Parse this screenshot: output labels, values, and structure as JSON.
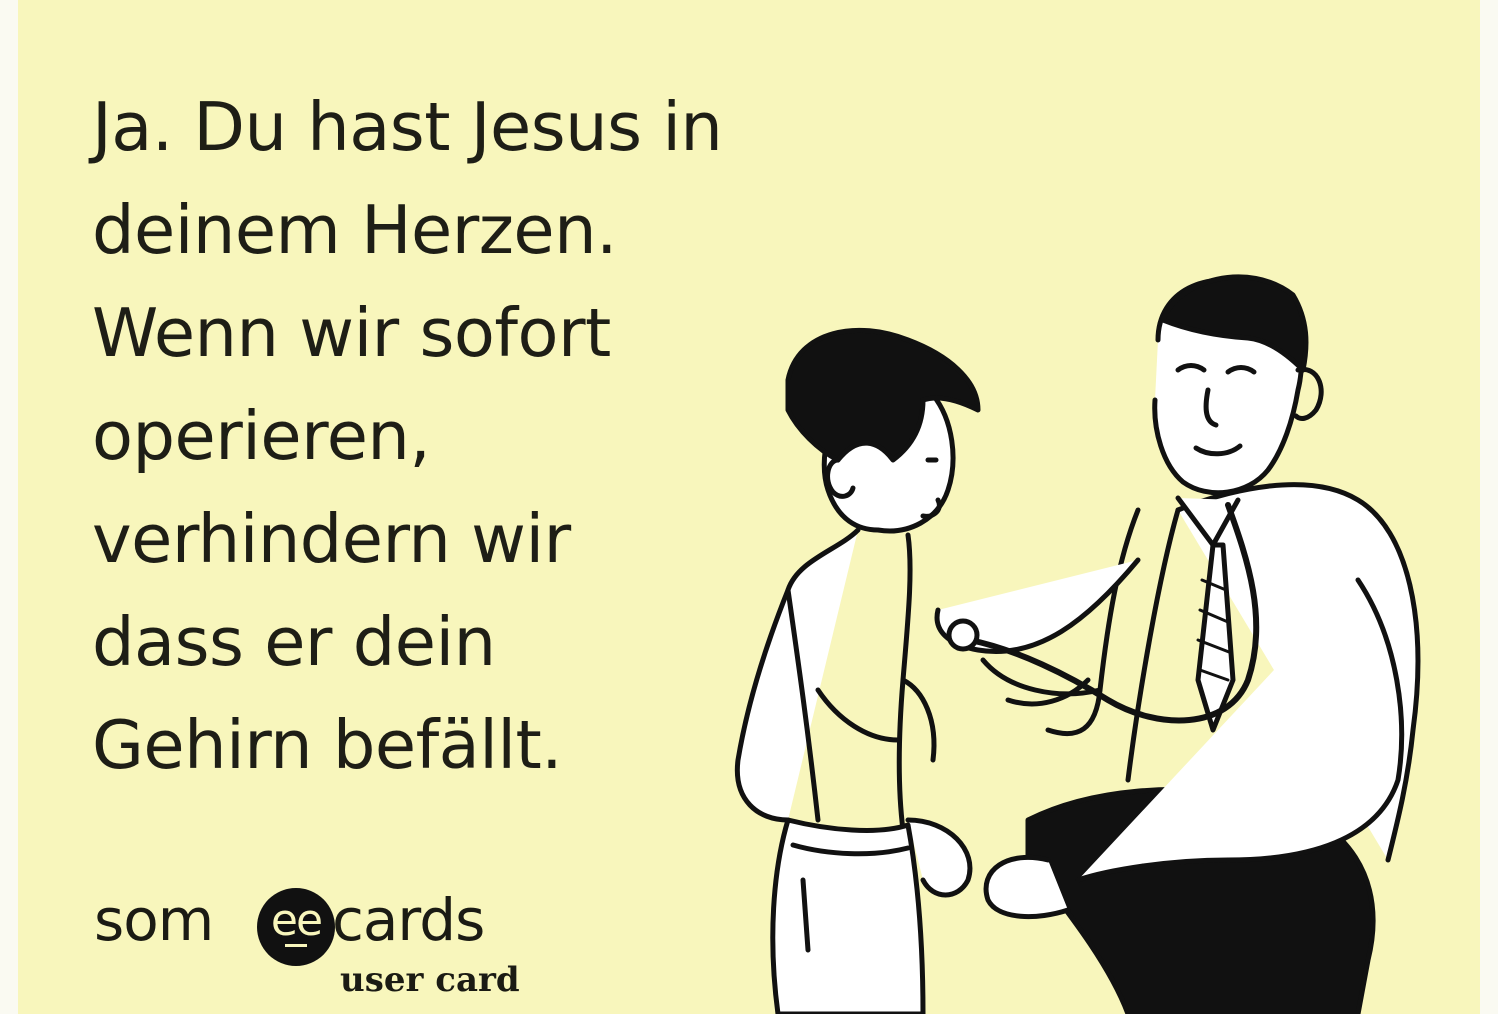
{
  "card": {
    "quote_lines": [
      "Ja. Du hast Jesus in",
      "deinem Herzen.",
      "Wenn wir sofort",
      "operieren,",
      "verhindern wir",
      "dass er dein",
      "Gehirn befällt."
    ],
    "logo": {
      "left_word": "som",
      "badge_text": "ee",
      "right_word": "cards",
      "subtitle": "user card"
    },
    "colors": {
      "background": "#f8f6bc",
      "ink": "#1e1e16"
    },
    "illustration": {
      "icon": "doctor-with-stethoscope-examining-boy-illustration"
    }
  }
}
